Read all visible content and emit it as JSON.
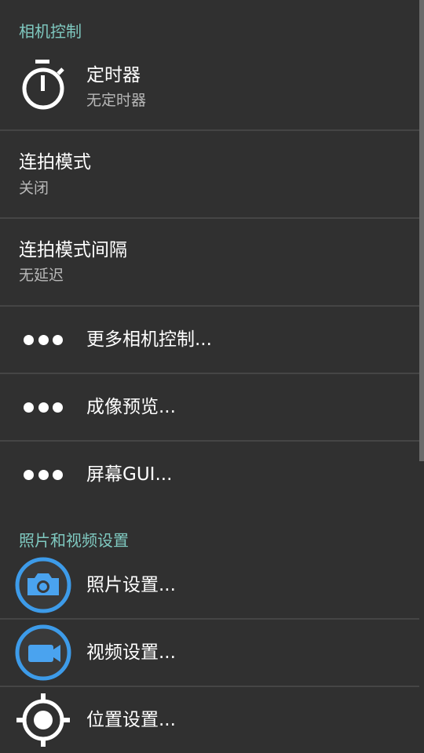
{
  "sections": {
    "camera_controls_header": "相机控制",
    "photo_video_header": "照片和视频设置"
  },
  "items": {
    "timer": {
      "title": "定时器",
      "summary": "无定时器",
      "icon": "stopwatch-icon"
    },
    "burst_mode": {
      "title": "连拍模式",
      "summary": "关闭"
    },
    "burst_interval": {
      "title": "连拍模式间隔",
      "summary": "无延迟"
    },
    "more_camera_controls": {
      "title": "更多相机控制...",
      "icon": "more-dots-icon"
    },
    "preview": {
      "title": "成像预览...",
      "icon": "more-dots-icon"
    },
    "screen_gui": {
      "title": "屏幕GUI...",
      "icon": "more-dots-icon"
    },
    "photo_settings": {
      "title": "照片设置...",
      "icon": "camera-icon"
    },
    "video_settings": {
      "title": "视频设置...",
      "icon": "video-camera-icon"
    },
    "location_settings": {
      "title": "位置设置...",
      "icon": "location-target-icon"
    }
  },
  "colors": {
    "background": "#303030",
    "section_header": "#7fc9c0",
    "accent_blue": "#3d9be9",
    "divider": "#454545",
    "summary_text": "#b8b8b8"
  }
}
